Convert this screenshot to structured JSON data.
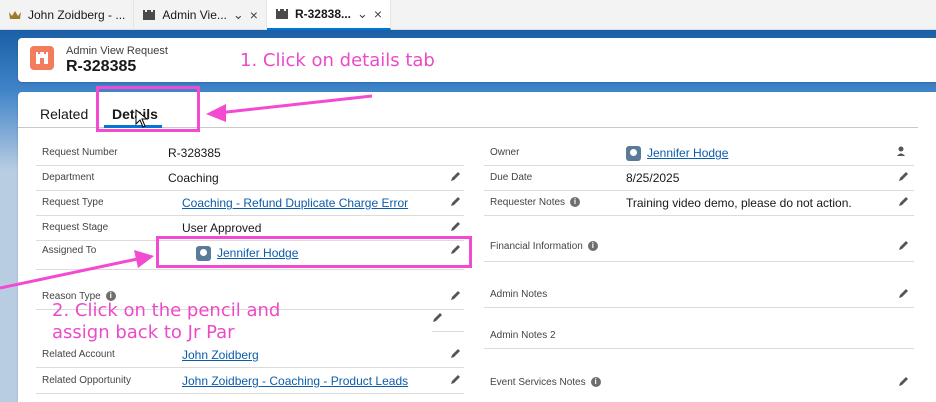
{
  "browser_tabs": [
    {
      "label": "John Zoidberg - ...",
      "icon": "crown-icon",
      "closable": false
    },
    {
      "label": "Admin Vie...",
      "icon": "castle-icon",
      "closable": true
    },
    {
      "label": "R-32838...",
      "icon": "castle-icon",
      "closable": true,
      "active": true
    }
  ],
  "record": {
    "type_label": "Admin View Request",
    "title": "R-328385"
  },
  "detail_tabs": {
    "related": "Related",
    "details": "Details"
  },
  "left_fields": [
    {
      "label": "Request Number",
      "value": "R-328385"
    },
    {
      "label": "Department",
      "value": "Coaching"
    },
    {
      "label": "Request Type",
      "value": "Coaching - Refund Duplicate Charge Error"
    },
    {
      "label": "Request Stage",
      "value": "User Approved"
    },
    {
      "label": "Assigned To",
      "value": "Jennifer Hodge"
    },
    {
      "label": "Reason Type",
      "value": ""
    },
    {
      "label": "Related Account",
      "value": "John Zoidberg"
    },
    {
      "label": "Related Opportunity",
      "value": "John Zoidberg - Coaching - Product Leads"
    }
  ],
  "right_fields": [
    {
      "label": "Owner",
      "value": "Jennifer Hodge"
    },
    {
      "label": "Due Date",
      "value": "8/25/2025"
    },
    {
      "label": "Requester Notes",
      "value": "Training video demo, please do not action."
    },
    {
      "label": "Financial Information",
      "value": ""
    },
    {
      "label": "Admin Notes",
      "value": ""
    },
    {
      "label": "Admin Notes 2",
      "value": ""
    },
    {
      "label": "Event Services Notes",
      "value": ""
    }
  ],
  "annotations": {
    "step1": "1. Click on details tab",
    "step2_line1": "2. Click on the pencil and",
    "step2_line2": "assign back to Jr Par",
    "color": "#ec4ac8"
  },
  "colors": {
    "accent": "#0176d3",
    "link": "#0b5cab",
    "record_icon": "#f27c5b"
  }
}
